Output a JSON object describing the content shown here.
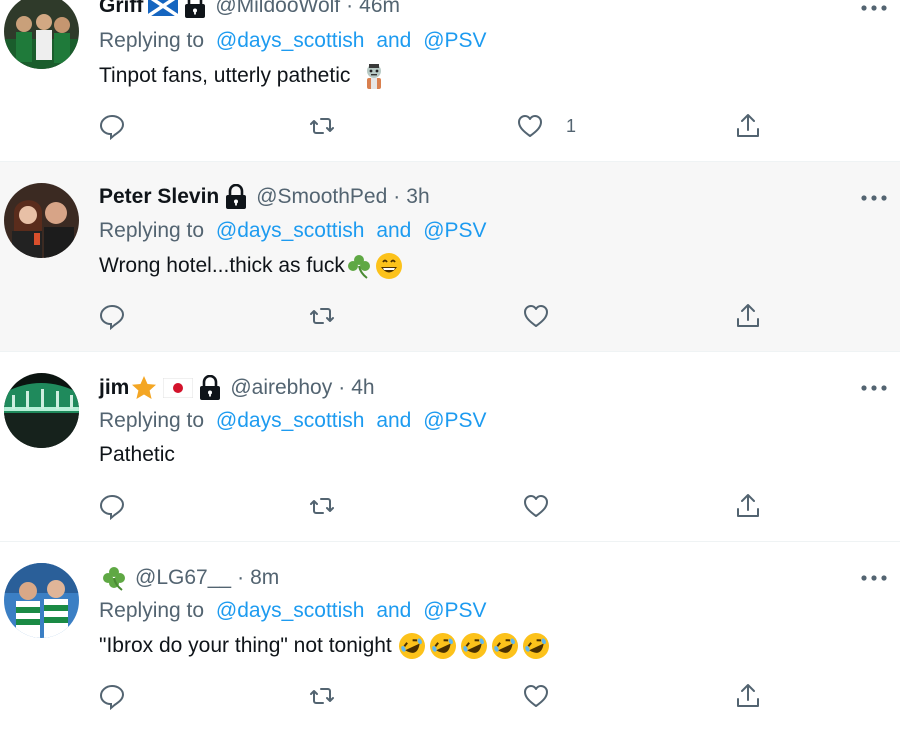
{
  "tweets": [
    {
      "name": "Griff",
      "handle": "@MildooWolf",
      "separator": "·",
      "time": "46m",
      "badges": [
        "scotland-flag-icon",
        "lock-icon"
      ],
      "replying_prefix": "Replying to",
      "replying_mention_1": "@days_scottish",
      "replying_and": "and",
      "replying_mention_2": "@PSV",
      "text": "Tinpot fans, utterly pathetic",
      "text_emojis": [
        "zombie-emoji-icon"
      ],
      "like_count": "1"
    },
    {
      "name": "Peter Slevin",
      "handle": "@SmoothPed",
      "separator": "·",
      "time": "3h",
      "badges": [
        "lock-icon"
      ],
      "replying_prefix": "Replying to",
      "replying_mention_1": "@days_scottish",
      "replying_and": "and",
      "replying_mention_2": "@PSV",
      "text": "Wrong hotel...thick as fuck",
      "text_emojis": [
        "shamrock-emoji-icon",
        "grinning-emoji-icon"
      ],
      "like_count": ""
    },
    {
      "name": "jim",
      "handle": "@airebhoy",
      "separator": "·",
      "time": "4h",
      "badges": [
        "star-emoji-icon",
        "japan-flag-icon",
        "lock-icon"
      ],
      "replying_prefix": "Replying to",
      "replying_mention_1": "@days_scottish",
      "replying_and": "and",
      "replying_mention_2": "@PSV",
      "text": "Pathetic",
      "text_emojis": [],
      "like_count": ""
    },
    {
      "name": "",
      "handle": "@LG67__",
      "separator": "·",
      "time": "8m",
      "badges": [
        "shamrock-emoji-icon"
      ],
      "replying_prefix": "Replying to",
      "replying_mention_1": "@days_scottish",
      "replying_and": "and",
      "replying_mention_2": "@PSV",
      "text": "\"Ibrox do your thing\" not tonight",
      "text_emojis": [
        "rofl-emoji-icon",
        "rofl-emoji-icon",
        "rofl-emoji-icon",
        "rofl-emoji-icon",
        "rofl-emoji-icon"
      ],
      "like_count": ""
    }
  ],
  "colors": {
    "mention": "#1d9bf0",
    "secondary_text": "#536471",
    "primary_text": "#0f1419",
    "shaded_bg": "#f7f7f7",
    "divider": "#eff3f4"
  },
  "icons": {
    "reply": "reply-icon",
    "retweet": "retweet-icon",
    "like": "heart-icon",
    "share": "share-icon",
    "more": "more-icon"
  }
}
